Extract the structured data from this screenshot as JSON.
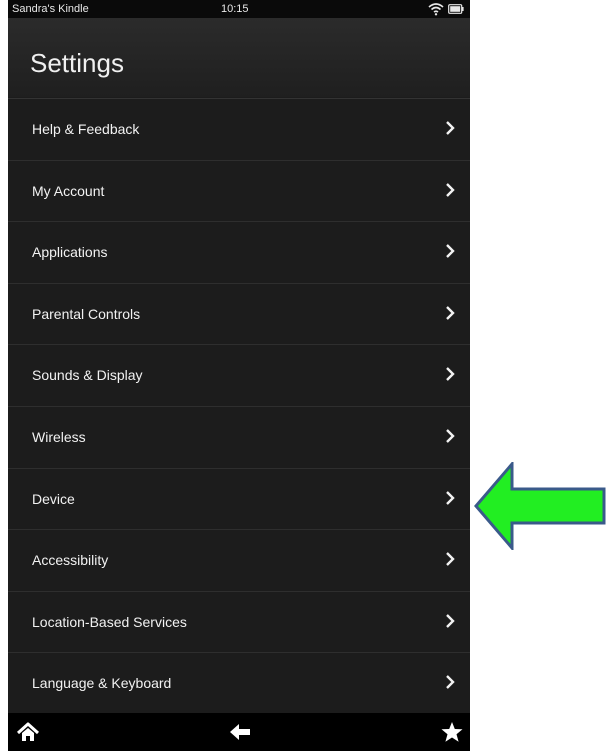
{
  "status_bar": {
    "owner": "Sandra's Kindle",
    "time": "10:15",
    "wifi_icon": "wifi-icon",
    "battery_icon": "battery-icon"
  },
  "header": {
    "title": "Settings"
  },
  "settings_items": [
    {
      "label": "Help & Feedback"
    },
    {
      "label": "My Account"
    },
    {
      "label": "Applications"
    },
    {
      "label": "Parental Controls"
    },
    {
      "label": "Sounds & Display"
    },
    {
      "label": "Wireless"
    },
    {
      "label": "Device"
    },
    {
      "label": "Accessibility"
    },
    {
      "label": "Location-Based Services"
    },
    {
      "label": "Language & Keyboard"
    }
  ],
  "nav_bar": {
    "home_icon": "home-icon",
    "back_icon": "back-arrow-icon",
    "favorites_icon": "star-icon"
  },
  "annotation": {
    "icon": "green-arrow-callout",
    "points_to": "Device",
    "fill_color": "#22ee22",
    "stroke_color": "#3a5a8a"
  },
  "colors": {
    "background": "#1c1c1c",
    "text": "#f2f2f2",
    "divider": "#2e2e2e"
  }
}
